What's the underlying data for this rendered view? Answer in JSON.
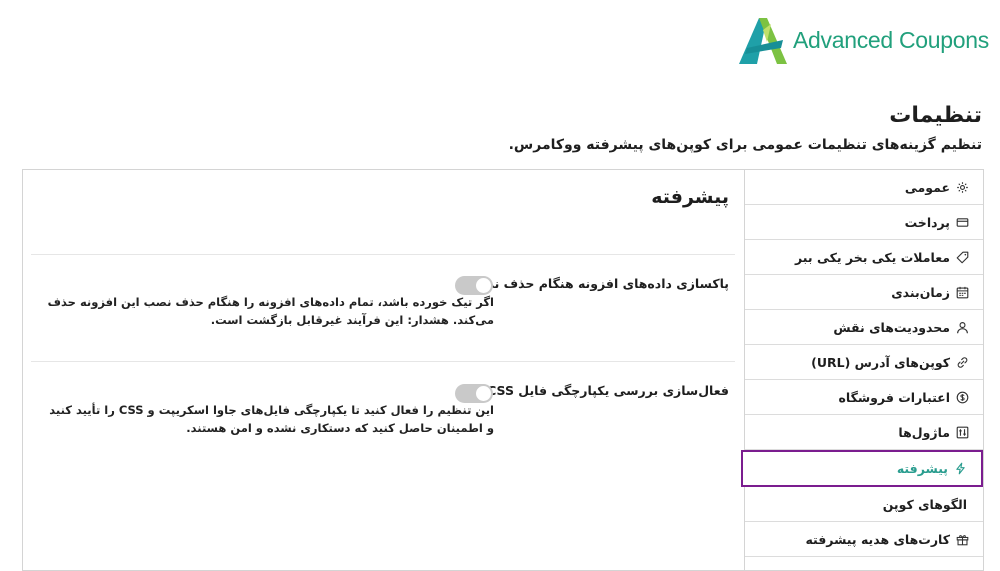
{
  "brand": {
    "name": "Advanced Coupons",
    "color": "#21a07c",
    "mark_colors": [
      "#1fa0a8",
      "#7cc242"
    ]
  },
  "header": {
    "title": "تنظیمات",
    "subtitle": "تنظیم گزینه‌های تنظیمات عمومی برای کوپن‌های پیشرفته ووکامرس."
  },
  "sidebar": {
    "active_color": "#2a9d8f",
    "active_border": "#7b1d8f",
    "items": [
      {
        "label": "عمومی",
        "icon": "gear-icon"
      },
      {
        "label": "پرداخت",
        "icon": "credit-card-icon"
      },
      {
        "label": "معاملات یکی بخر یکی ببر",
        "icon": "tag-icon"
      },
      {
        "label": "زمان‌بندی",
        "icon": "calendar-icon"
      },
      {
        "label": "محدودیت‌های نقش",
        "icon": "user-icon"
      },
      {
        "label": "کوپن‌های آدرس (URL)",
        "icon": "link-icon"
      },
      {
        "label": "اعتبارات فروشگاه",
        "icon": "dollar-circle-icon"
      },
      {
        "label": "ماژول‌ها",
        "icon": "sliders-icon"
      },
      {
        "label": "پیشرفته",
        "icon": "bolt-icon",
        "active": true
      },
      {
        "label": "الگوهای کوپن",
        "icon": ""
      },
      {
        "label": "کارت‌های هدیه پیشرفته",
        "icon": "gift-icon"
      }
    ]
  },
  "main": {
    "section_title": "پیشرفته",
    "settings": [
      {
        "label": "پاکسازی داده‌های افزونه هنگام حذف نصب",
        "enabled": false,
        "description": "اگر تیک خورده باشد، تمام داده‌های افزونه را هنگام حذف نصب این افزونه حذف می‌کند. هشدار: این فرآیند غیرقابل بازگشت است."
      },
      {
        "label": "فعال‌سازی بررسی یکپارچگی فایل JS/CSS",
        "enabled": false,
        "description": "این تنظیم را فعال کنید تا یکپارچگی فایل‌های جاوا اسکریپت و CSS را تأیید کنید و اطمینان حاصل کنید که دستکاری نشده و امن هستند."
      }
    ]
  }
}
